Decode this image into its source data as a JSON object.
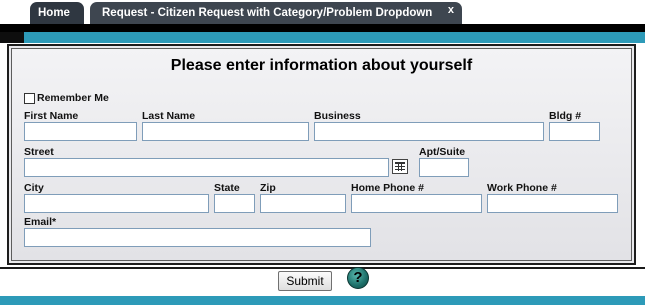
{
  "tabs": [
    {
      "label": "Home"
    },
    {
      "label": "Request - Citizen Request with Category/Problem Dropdown",
      "close": "x"
    }
  ],
  "form": {
    "title": "Please enter information about yourself",
    "remember_me": "Remember Me",
    "labels": {
      "first_name": "First Name",
      "last_name": "Last Name",
      "business": "Business",
      "bldg": "Bldg #",
      "street": "Street",
      "apt": "Apt/Suite",
      "city": "City",
      "state": "State",
      "zip": "Zip",
      "home_phone": "Home Phone #",
      "work_phone": "Work Phone #",
      "email": "Email*"
    },
    "values": {
      "first_name": "",
      "last_name": "",
      "business": "",
      "bldg": "",
      "street": "",
      "apt": "",
      "city": "",
      "state": "",
      "zip": "",
      "home_phone": "",
      "work_phone": "",
      "email": ""
    }
  },
  "actions": {
    "submit": "Submit",
    "help": "?"
  },
  "icons": {
    "address_lookup": "address-lookup-icon",
    "help": "help-icon"
  },
  "colors": {
    "accent": "#2d9ab8",
    "tab_bg": "#2f3741"
  }
}
